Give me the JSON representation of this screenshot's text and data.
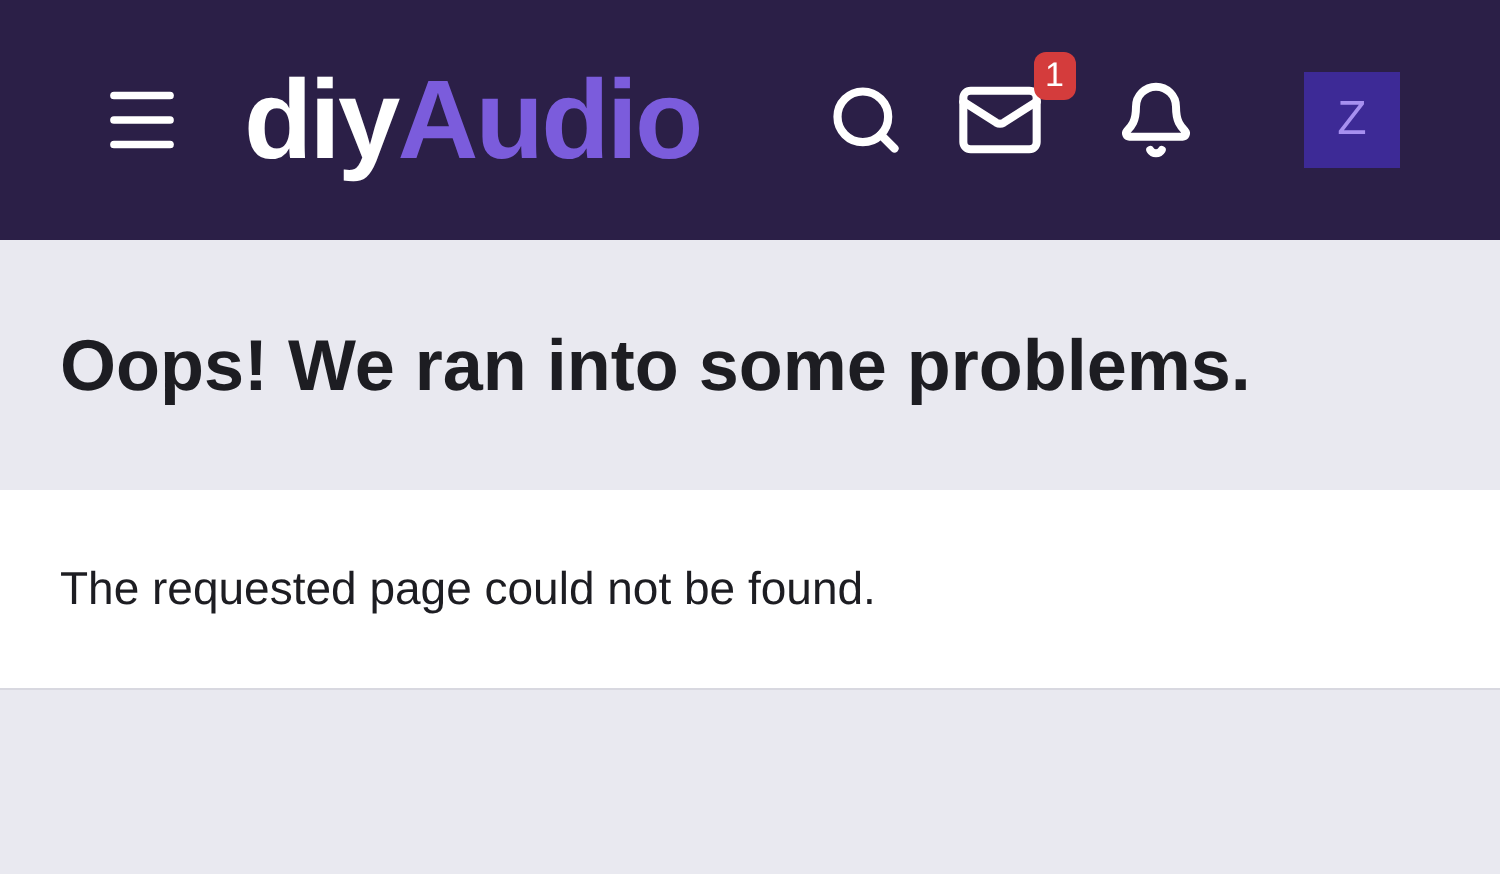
{
  "header": {
    "logo": {
      "prefix": "diy",
      "suffix": "Audio"
    },
    "mail_badge": "1",
    "avatar": "Z"
  },
  "error": {
    "title": "Oops! We ran into some problems.",
    "message": "The requested page could not be found."
  }
}
